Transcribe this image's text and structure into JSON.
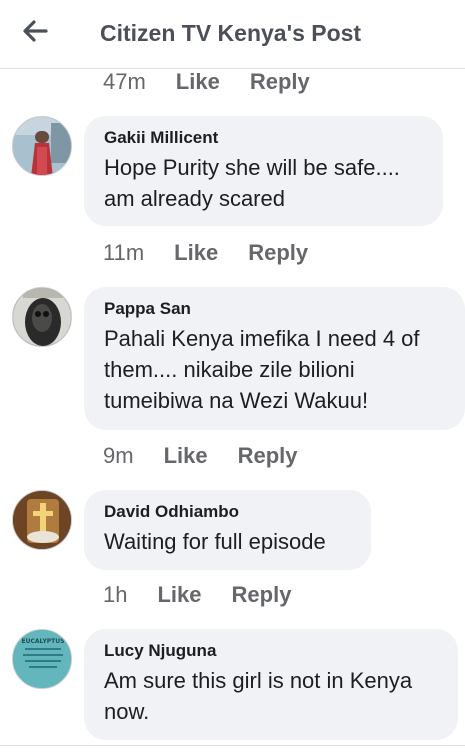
{
  "header": {
    "title": "Citizen TV Kenya's Post",
    "back_icon": "back-arrow-icon"
  },
  "top_actions": {
    "time": "47m",
    "like": "Like",
    "reply": "Reply"
  },
  "comments": [
    {
      "author": "Gakii Millicent",
      "text": "Hope Purity she will be safe.... am already scared",
      "time": "11m",
      "like": "Like",
      "reply": "Reply"
    },
    {
      "author": "Pappa San",
      "text": "Pahali Kenya imefika I need 4 of them.... nikaibe zile bilioni tumeibiwa na Wezi Wakuu!",
      "time": "9m",
      "like": "Like",
      "reply": "Reply"
    },
    {
      "author": "David Odhiambo",
      "text": "Waiting for full episode",
      "time": "1h",
      "like": "Like",
      "reply": "Reply"
    },
    {
      "author": "Lucy Njuguna",
      "text": "Am sure this girl is not in Kenya now.",
      "avatar_caption": "EUCALYPTUS"
    }
  ],
  "colors": {
    "bubble_bg": "#f0f2f5",
    "meta_text": "#65676b",
    "header_text": "#4b4f56"
  }
}
